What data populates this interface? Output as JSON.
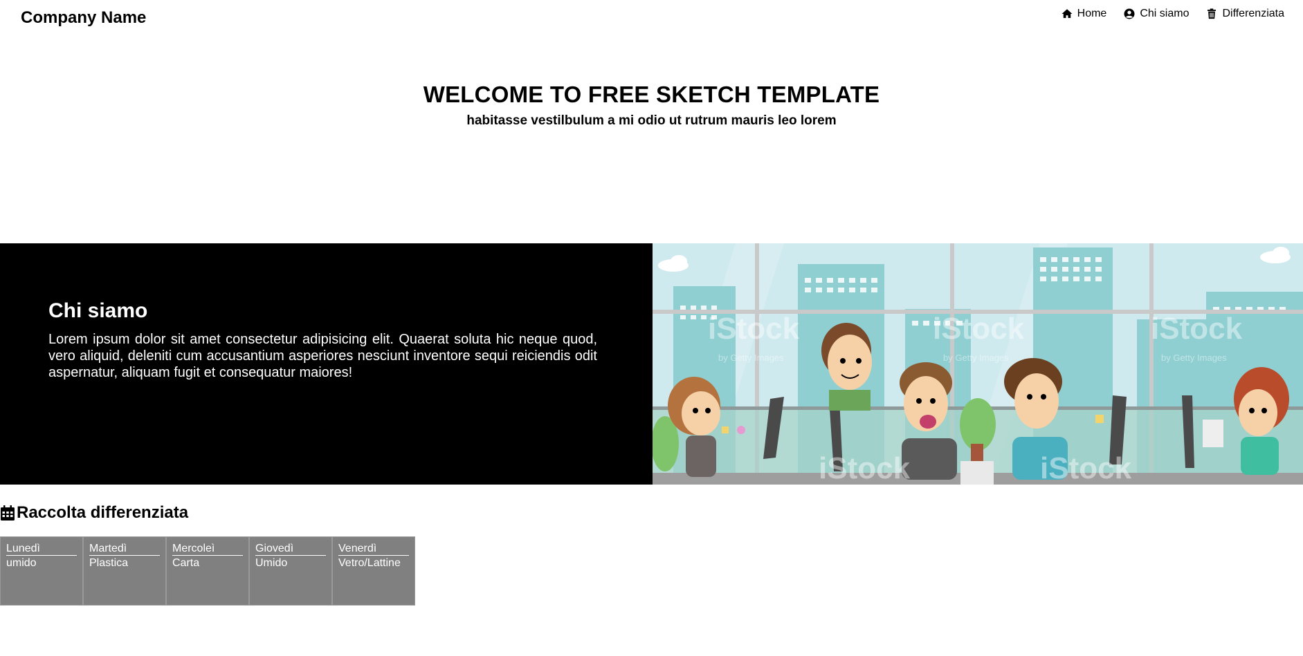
{
  "header": {
    "brand": "Company Name",
    "nav": [
      {
        "label": "Home",
        "icon": "home-icon"
      },
      {
        "label": "Chi siamo",
        "icon": "user-circle-icon"
      },
      {
        "label": "Differenziata",
        "icon": "trash-icon"
      }
    ]
  },
  "hero": {
    "title": "WELCOME TO FREE SKETCH TEMPLATE",
    "subtitle": "habitasse vestilbulum a mi odio ut rutrum mauris leo lorem"
  },
  "about": {
    "title": "Chi siamo",
    "body": "Lorem ipsum dolor sit amet consectetur adipisicing elit. Quaerat soluta hic neque quod, vero aliquid, deleniti cum accusantium asperiores nesciunt inventore sequi reiciendis odit aspernatur, aliquam fugit et consequatur maiores!",
    "watermark": "iStock",
    "watermark_sub": "by Getty Images"
  },
  "waste": {
    "title": "Raccolta differenziata",
    "icon": "calendar-icon",
    "days": [
      {
        "day": "Lunedì",
        "type": "umido"
      },
      {
        "day": "Martedì",
        "type": "Plastica"
      },
      {
        "day": "Mercoleì",
        "type": "Carta"
      },
      {
        "day": "Giovedì",
        "type": "Umido"
      },
      {
        "day": "Venerdì",
        "type": "Vetro/Lattine"
      }
    ]
  },
  "colors": {
    "about_bg": "#000000",
    "cell_bg": "#808080",
    "sky": "#cbe9ee",
    "building": "#8fd0d3"
  }
}
